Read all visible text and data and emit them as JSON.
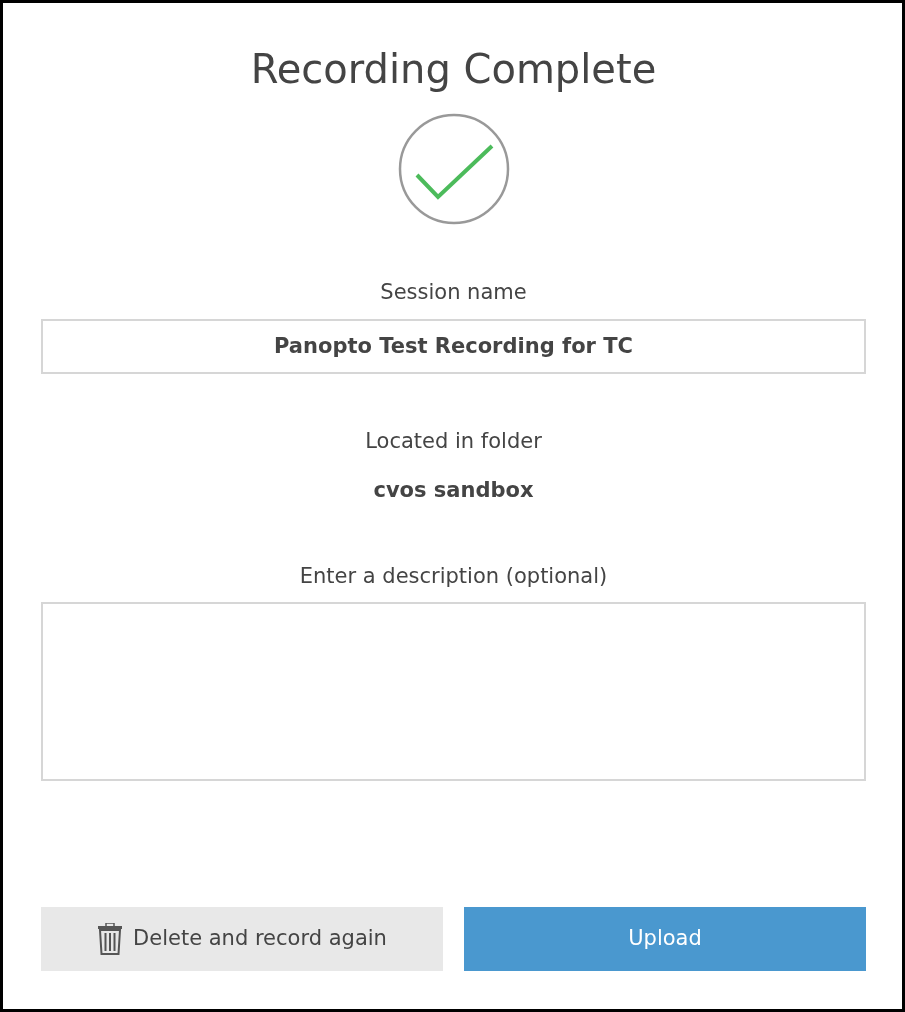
{
  "title": "Recording Complete",
  "session": {
    "label": "Session name",
    "value": "Panopto Test Recording for TC"
  },
  "folder": {
    "label": "Located in folder",
    "name": "cvos sandbox"
  },
  "description": {
    "label": "Enter a description (optional)"
  },
  "buttons": [
    {
      "kind": "secondary",
      "label": "Delete and record again"
    },
    {
      "kind": "primary",
      "label": "Upload"
    }
  ]
}
